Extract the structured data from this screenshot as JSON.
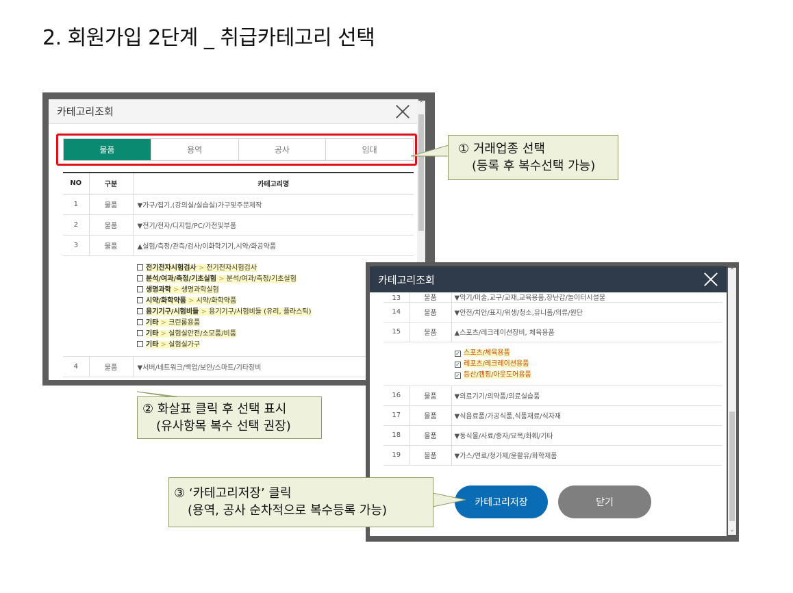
{
  "page_title": "2. 회원가입 2단계 _ 취급카테고리 선택",
  "modal1": {
    "title": "카테고리조회",
    "tabs": [
      "물품",
      "용역",
      "공사",
      "임대"
    ],
    "headers": [
      "NO",
      "구분",
      "카테고리명"
    ],
    "rows": [
      {
        "no": "1",
        "div": "물품",
        "name": "▼가구/집기,(강의실/실습실)가구및주문제작"
      },
      {
        "no": "2",
        "div": "물품",
        "name": "▼전기/전자/디지털/PC/가전및부품"
      },
      {
        "no": "3",
        "div": "물품",
        "name": "▲실험/측정/관측/검사/이화학기기,시약/화공약품"
      }
    ],
    "sub_items": [
      {
        "bold": "전기전자시험검사",
        "arrow": " > ",
        "rest": "전기전자시험검사"
      },
      {
        "bold": "분석/여과/측정/기초실험",
        "arrow": " > ",
        "rest": "분석/여과/측정/기초실험"
      },
      {
        "bold": "생명과학",
        "arrow": " > ",
        "rest": "생명과학실험"
      },
      {
        "bold": "시약/화학약품",
        "arrow": " > ",
        "rest": "시약/화학약품"
      },
      {
        "bold": "용기기구/시험비들",
        "arrow": " > ",
        "rest": "용기기구/시험비들 (유리, 플라스틱)"
      },
      {
        "bold": "기타",
        "arrow": " > ",
        "rest": "크린룸용품"
      },
      {
        "bold": "기타",
        "arrow": " > ",
        "rest": "실험실안전/소모품/비품"
      },
      {
        "bold": "기타",
        "arrow": " > ",
        "rest": "실험실가구"
      }
    ],
    "row4": {
      "no": "4",
      "div": "물품",
      "name": "▼서버/네트워크/백업/보안/스마트/기타장비"
    }
  },
  "callouts": {
    "c1": [
      "① 거래업종 선택",
      "(등록 후 복수선택 가능)"
    ],
    "c2": [
      "② 화살표 클릭 후 선택 표시",
      "(유사항목 복수 선택 권장)"
    ],
    "c3": [
      "③ ‘카테고리저장’ 클릭",
      "(용역, 공사 순차적으로 복수등록 가능)"
    ]
  },
  "modal2": {
    "title": "카테고리조회",
    "rows_top": [
      {
        "no": "13",
        "div": "물품",
        "name": "▼악기/미술,교구/교재,교육용품,장난감/놀이터시설물"
      },
      {
        "no": "14",
        "div": "물품",
        "name": "▼안전/치안/표지/위생/청소,유니폼/의류/원단"
      },
      {
        "no": "15",
        "div": "물품",
        "name": "▲스포츠/레크레이션장비, 체육용품"
      }
    ],
    "sub_items": [
      "스포츠/체육용품",
      "레포츠/레크레이션용품",
      "등산/캠핑/아웃도어용품"
    ],
    "rows_bottom": [
      {
        "no": "16",
        "div": "물품",
        "name": "▼의료기기/의약품/의료실습품"
      },
      {
        "no": "17",
        "div": "물품",
        "name": "▼식음료품/가공식품,식품재료/식자재"
      },
      {
        "no": "18",
        "div": "물품",
        "name": "▼동식물/사료/종자/묘목/화훼/기타"
      },
      {
        "no": "19",
        "div": "물품",
        "name": "▼가스/연료/청가제/윤활유/화학제품"
      }
    ],
    "save_label": "카테고리저장",
    "close_label": "닫기"
  }
}
